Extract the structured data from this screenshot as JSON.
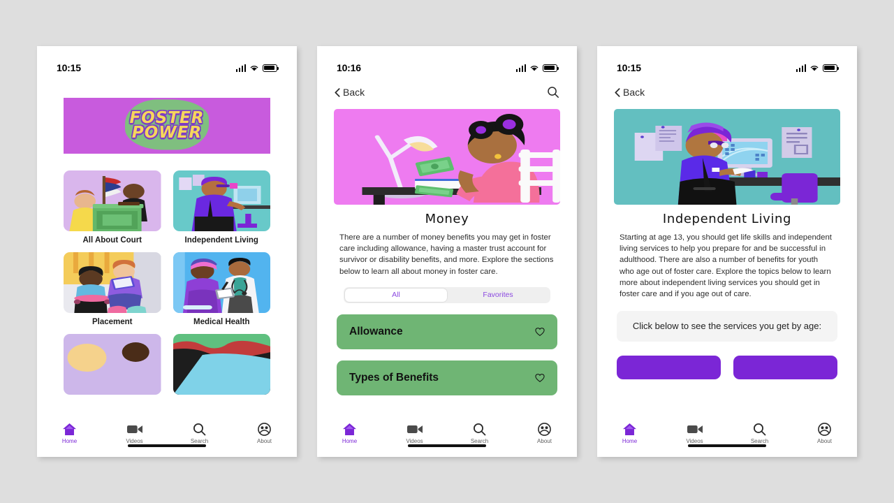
{
  "app": {
    "name": "Foster Power",
    "brand_purple": "#7b26d6",
    "brand_green": "#6fb574",
    "brand_magenta": "#c85bdd",
    "background": "#dedede"
  },
  "screens": [
    {
      "id": "home",
      "status": {
        "time": "10:15",
        "signal_icon": "cellular-signal-icon",
        "wifi_icon": "wifi-icon",
        "battery_icon": "battery-icon"
      },
      "logo": {
        "line1": "FOSTER",
        "line2": "POWER"
      },
      "tiles": [
        {
          "label": "All About Court",
          "art": "courtroom-illustration"
        },
        {
          "label": "Independent Living",
          "art": "office-desk-illustration"
        },
        {
          "label": "Placement",
          "art": "two-youth-reading-illustration"
        },
        {
          "label": "Medical Health",
          "art": "doctor-and-patient-illustration"
        },
        {
          "label": "",
          "art": "partial-tile-illustration-left"
        },
        {
          "label": "",
          "art": "partial-tile-illustration-right"
        }
      ],
      "tabs": [
        {
          "label": "Home",
          "icon": "home-icon",
          "active": true
        },
        {
          "label": "Videos",
          "icon": "video-camera-icon",
          "active": false
        },
        {
          "label": "Search",
          "icon": "search-icon",
          "active": false
        },
        {
          "label": "About",
          "icon": "people-circle-icon",
          "active": false
        }
      ]
    },
    {
      "id": "money",
      "status": {
        "time": "10:16",
        "signal_icon": "cellular-signal-icon",
        "wifi_icon": "wifi-icon",
        "battery_icon": "battery-icon"
      },
      "header": {
        "back_label": "Back",
        "back_icon": "chevron-left-icon",
        "search_icon": "search-icon",
        "has_search": true
      },
      "hero_art": "woman-counting-money-at-desk-illustration",
      "title": "Money",
      "body": "There are a number of money benefits you may get in foster care including allowance, having a master trust account for survivor or disability benefits, and more. Explore the sections below to learn all about money in foster care.",
      "segmented": {
        "options": [
          "All",
          "Favorites"
        ],
        "selected": "All"
      },
      "cards": [
        {
          "label": "Allowance",
          "favorite_icon": "heart-outline-icon"
        },
        {
          "label": "Types of Benefits",
          "favorite_icon": "heart-outline-icon"
        }
      ],
      "tabs": [
        {
          "label": "Home",
          "icon": "home-icon",
          "active": true
        },
        {
          "label": "Videos",
          "icon": "video-camera-icon",
          "active": false
        },
        {
          "label": "Search",
          "icon": "search-icon",
          "active": false
        },
        {
          "label": "About",
          "icon": "people-circle-icon",
          "active": false
        }
      ]
    },
    {
      "id": "independent-living",
      "status": {
        "time": "10:15",
        "signal_icon": "cellular-signal-icon",
        "wifi_icon": "wifi-icon",
        "battery_icon": "battery-icon"
      },
      "header": {
        "back_label": "Back",
        "back_icon": "chevron-left-icon",
        "has_search": false
      },
      "hero_art": "person-at-computer-desk-illustration",
      "title": "Independent Living",
      "body": "Starting at age 13, you should get life skills and independent living services to help you prepare for and be successful in adulthood. There are also a number of benefits for youth who age out of foster care. Explore the topics below to learn more about independent living services you should get in foster care and if you age out of care.",
      "cta": "Click below to see the services you get by age:",
      "age_buttons": [
        "",
        ""
      ],
      "tabs": [
        {
          "label": "Home",
          "icon": "home-icon",
          "active": true
        },
        {
          "label": "Videos",
          "icon": "video-camera-icon",
          "active": false
        },
        {
          "label": "Search",
          "icon": "search-icon",
          "active": false
        },
        {
          "label": "About",
          "icon": "people-circle-icon",
          "active": false
        }
      ]
    }
  ]
}
